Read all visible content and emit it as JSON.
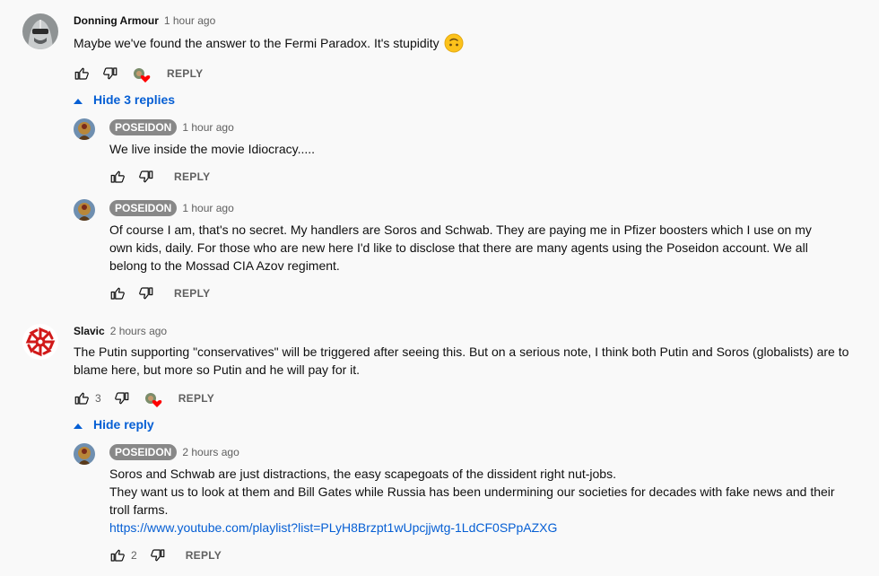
{
  "comments": [
    {
      "author": "Donning Armour",
      "time": "1 hour ago",
      "text": "Maybe we've found the answer to the Fermi Paradox. It's stupidity",
      "emoji": "🙃",
      "reply_label": "REPLY",
      "toggle_label": "Hide 3 replies"
    },
    {
      "author": "Slavic",
      "time": "2 hours ago",
      "text": "The Putin supporting \"conservatives\" will be triggered after seeing this. But on a serious note, I think both Putin and Soros (globalists) are to blame here, but more so Putin and he will pay for it.",
      "likes": "3",
      "reply_label": "REPLY",
      "toggle_label": "Hide reply"
    }
  ],
  "replies": [
    {
      "author": "POSEIDON",
      "time": "1 hour ago",
      "text": "We live inside the movie Idiocracy.....",
      "reply_label": "REPLY"
    },
    {
      "author": "POSEIDON",
      "time": "1 hour ago",
      "text": "Of course I am, that's no secret. My handlers are Soros and Schwab. They are paying me in Pfizer boosters which I use on my own kids, daily. For those who are new here I'd like to disclose that there are many agents using the Poseidon account. We all belong to the Mossad CIA Azov regiment.",
      "reply_label": "REPLY"
    },
    {
      "author": "POSEIDON",
      "time": "2 hours ago",
      "line1": "Soros and Schwab are just distractions, the easy scapegoats of the dissident right nut-jobs.",
      "line2": "They want us to look at them and Bill Gates while Russia has been undermining our societies for decades with fake news and their troll farms.",
      "link": "https://www.youtube.com/playlist?list=PLyH8Brzpt1wUpcjjwtg-1LdCF0SPpAZXG",
      "likes": "2",
      "reply_label": "REPLY"
    }
  ],
  "icons": {
    "like": "thumb-up-icon",
    "dislike": "thumb-down-icon",
    "creator_heart": "heart-icon",
    "toggle": "caret-up-icon"
  },
  "colors": {
    "link": "#065fd4",
    "heart": "#ff0000",
    "badge": "#888888"
  }
}
